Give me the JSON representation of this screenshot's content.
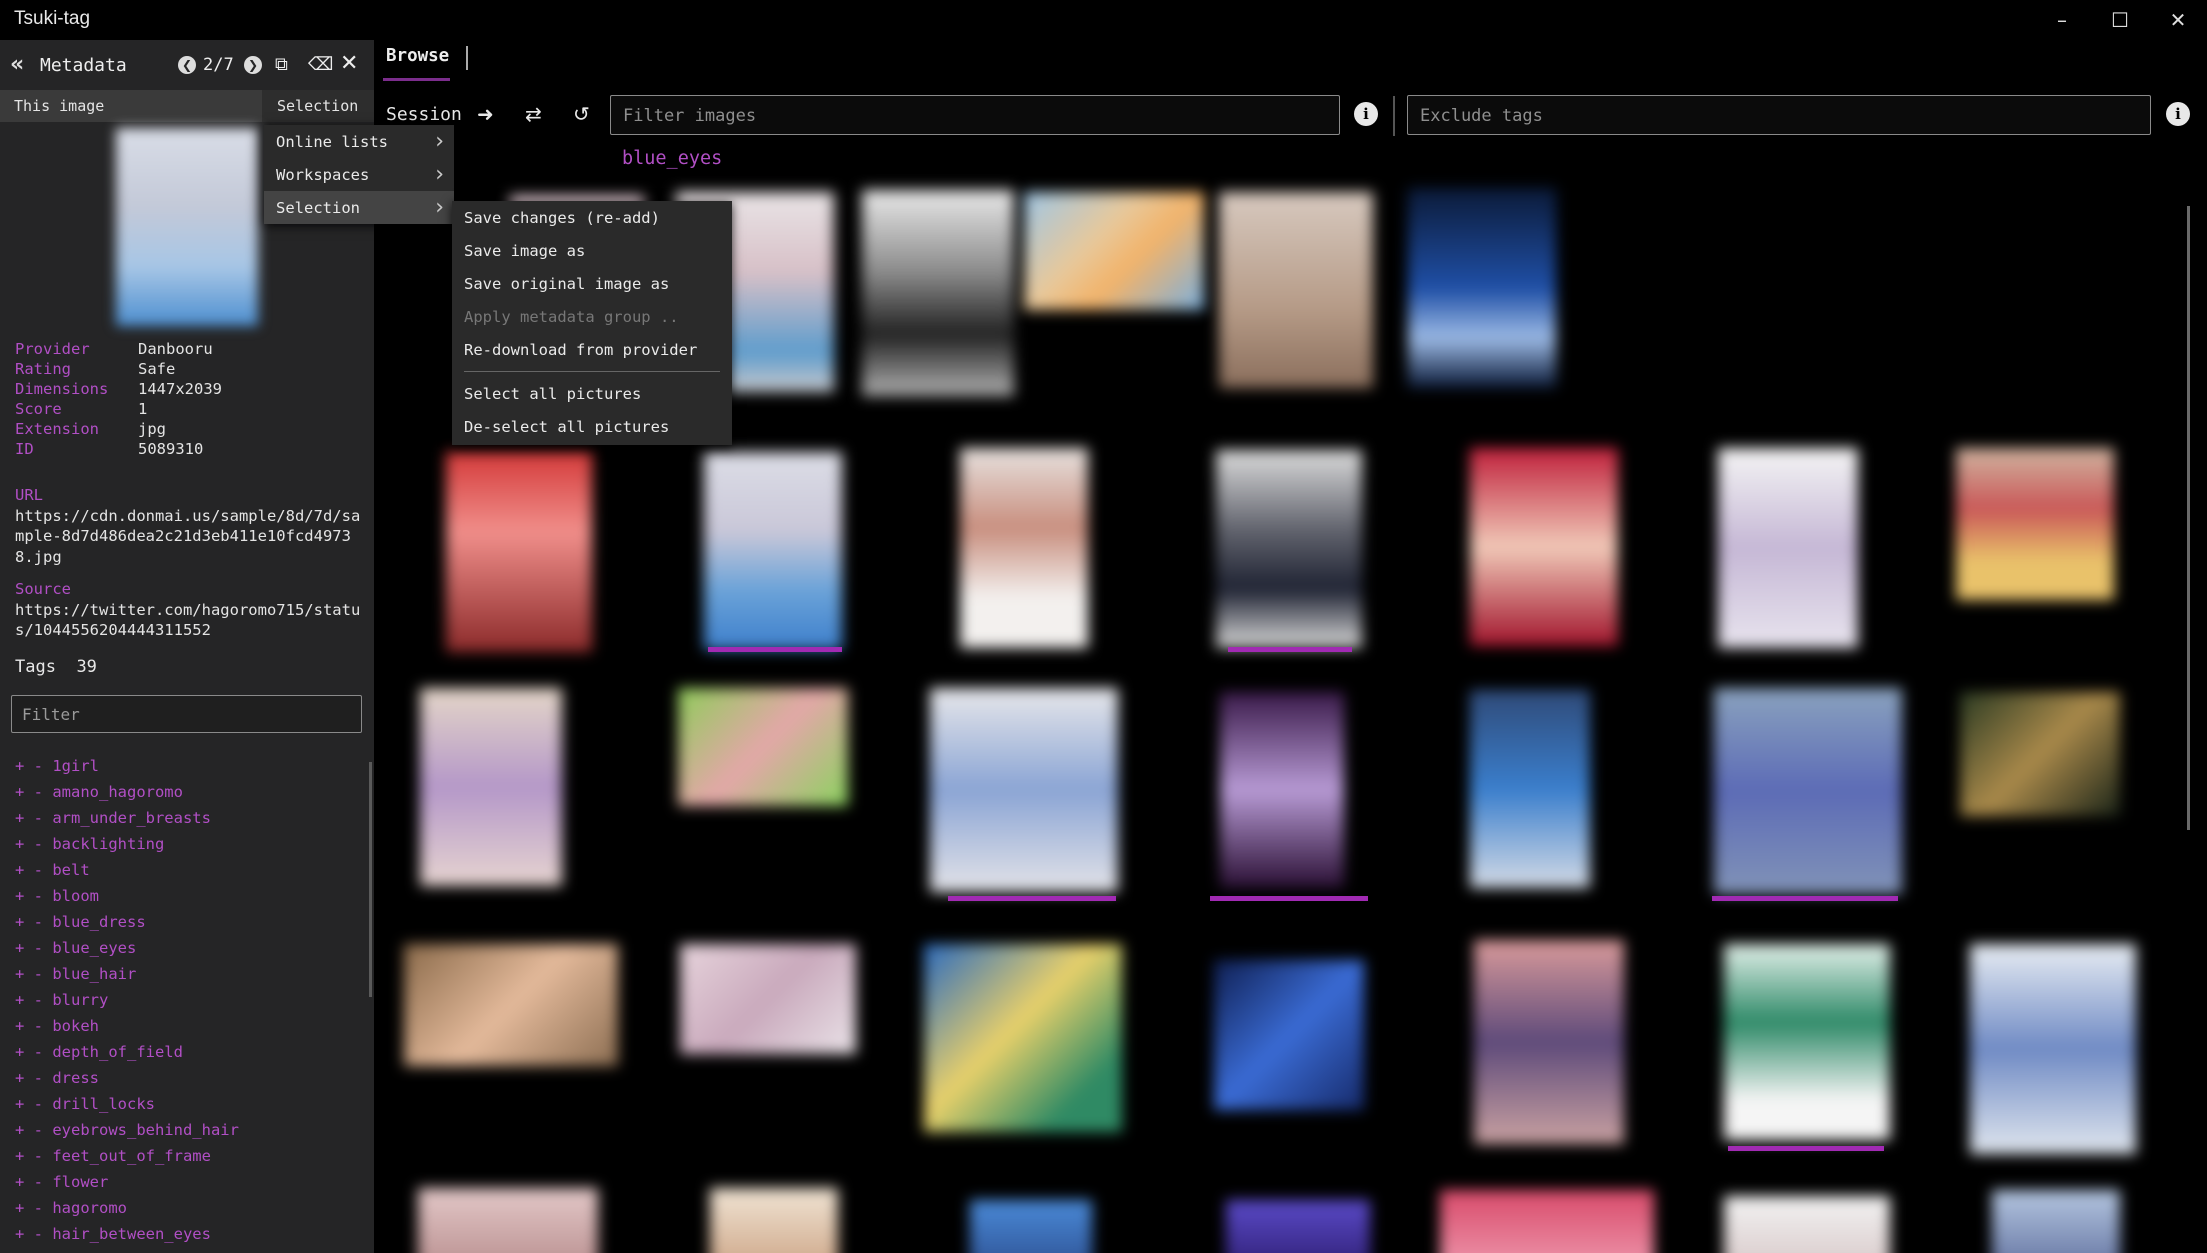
{
  "window": {
    "title": "Tsuki-tag",
    "controls": [
      "minimize-icon",
      "maximize-icon",
      "close-icon"
    ]
  },
  "sidebar": {
    "title": "Metadata",
    "page_indicator": "2/7",
    "tabs": {
      "this_image": "This image",
      "selection": "Selection"
    },
    "metadata": [
      {
        "key": "Provider",
        "value": "Danbooru"
      },
      {
        "key": "Rating",
        "value": "Safe"
      },
      {
        "key": "Dimensions",
        "value": "1447x2039"
      },
      {
        "key": "Score",
        "value": "1"
      },
      {
        "key": "Extension",
        "value": "jpg"
      },
      {
        "key": "ID",
        "value": "5089310"
      }
    ],
    "url_label": "URL",
    "url_value": "https://cdn.donmai.us/sample/8d/7d/sample-8d7d486dea2c21d3eb411e10fcd49738.jpg",
    "source_label": "Source",
    "source_value": "https://twitter.com/hagoromo715/status/1044556204444311552",
    "tags_label": "Tags",
    "tags_count": "39",
    "filter_placeholder": "Filter",
    "tags": [
      "1girl",
      "amano_hagoromo",
      "arm_under_breasts",
      "backlighting",
      "belt",
      "bloom",
      "blue_dress",
      "blue_eyes",
      "blue_hair",
      "blurry",
      "bokeh",
      "depth_of_field",
      "dress",
      "drill_locks",
      "eyebrows_behind_hair",
      "feet_out_of_frame",
      "flower",
      "hagoromo",
      "hair_between_eyes"
    ]
  },
  "main": {
    "tab_label": "Browse",
    "session_label": "Session",
    "filter_placeholder": "Filter images",
    "exclude_placeholder": "Exclude tags",
    "active_tag": "blue_eyes"
  },
  "menus": {
    "level1": [
      "Online lists",
      "Workspaces",
      "Selection"
    ],
    "level2": [
      {
        "label": "Save changes (re-add)",
        "enabled": true
      },
      {
        "label": "Save image as",
        "enabled": true
      },
      {
        "label": "Save original image as",
        "enabled": true
      },
      {
        "label": "Apply metadata group ..",
        "enabled": false
      },
      {
        "label": "Re-download from provider",
        "enabled": true
      }
    ],
    "level2_bottom": [
      {
        "label": "Select all pictures",
        "enabled": true
      },
      {
        "label": "De-select all pictures",
        "enabled": true
      }
    ]
  },
  "colors": {
    "accent": "#b14fc5",
    "selection_bar": "#a12ab3",
    "sidebar_bg": "#252526",
    "main_bg": "#000000"
  }
}
